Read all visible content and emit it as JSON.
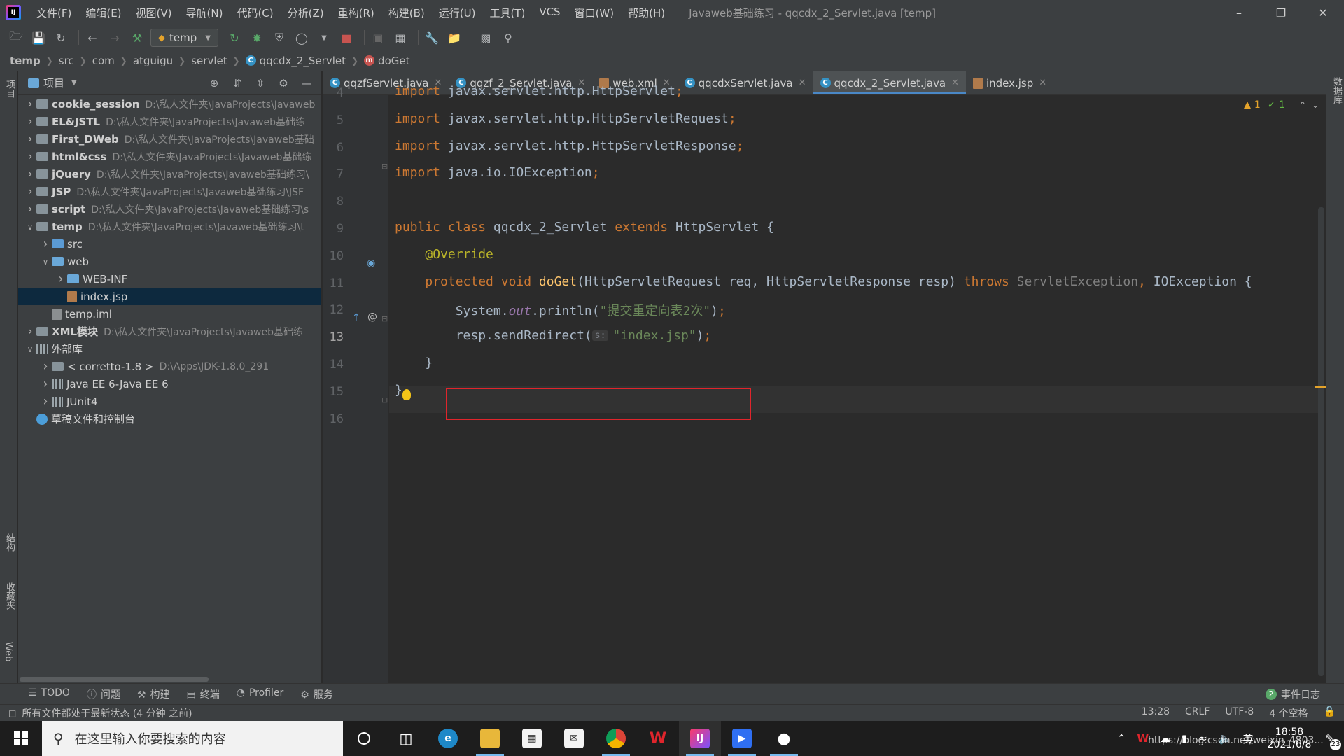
{
  "app": {
    "window_title": "Javaweb基础练习 - qqcdx_2_Servlet.java [temp]",
    "menu": [
      "文件(F)",
      "编辑(E)",
      "视图(V)",
      "导航(N)",
      "代码(C)",
      "分析(Z)",
      "重构(R)",
      "构建(B)",
      "运行(U)",
      "工具(T)",
      "VCS",
      "窗口(W)",
      "帮助(H)"
    ]
  },
  "toolbar": {
    "run_config": "temp"
  },
  "breadcrumb": [
    "temp",
    "src",
    "com",
    "atguigu",
    "servlet",
    "qqcdx_2_Servlet",
    "doGet"
  ],
  "project_panel": {
    "title": "项目",
    "tree": [
      {
        "name": "cookie_session",
        "path": "D:\\私人文件夹\\JavaProjects\\Javaweb",
        "level": 0,
        "expanded": false,
        "bold": true,
        "icon": "module-folder"
      },
      {
        "name": "EL&JSTL",
        "path": "D:\\私人文件夹\\JavaProjects\\Javaweb基础练",
        "level": 0,
        "expanded": false,
        "bold": true,
        "icon": "module-folder"
      },
      {
        "name": "First_DWeb",
        "path": "D:\\私人文件夹\\JavaProjects\\Javaweb基础",
        "level": 0,
        "expanded": false,
        "bold": true,
        "icon": "module-folder"
      },
      {
        "name": "html&css",
        "path": "D:\\私人文件夹\\JavaProjects\\Javaweb基础练",
        "level": 0,
        "expanded": false,
        "bold": true,
        "icon": "module-folder"
      },
      {
        "name": "jQuery",
        "path": "D:\\私人文件夹\\JavaProjects\\Javaweb基础练习\\",
        "level": 0,
        "expanded": false,
        "bold": true,
        "icon": "module-folder"
      },
      {
        "name": "JSP",
        "path": "D:\\私人文件夹\\JavaProjects\\Javaweb基础练习\\JSF",
        "level": 0,
        "expanded": false,
        "bold": true,
        "icon": "module-folder"
      },
      {
        "name": "script",
        "path": "D:\\私人文件夹\\JavaProjects\\Javaweb基础练习\\s",
        "level": 0,
        "expanded": false,
        "bold": true,
        "icon": "module-folder"
      },
      {
        "name": "temp",
        "path": "D:\\私人文件夹\\JavaProjects\\Javaweb基础练习\\t",
        "level": 0,
        "expanded": true,
        "bold": true,
        "icon": "module-folder"
      },
      {
        "name": "src",
        "path": "",
        "level": 1,
        "expanded": false,
        "bold": false,
        "icon": "source-folder"
      },
      {
        "name": "web",
        "path": "",
        "level": 1,
        "expanded": true,
        "bold": false,
        "icon": "web-folder"
      },
      {
        "name": "WEB-INF",
        "path": "",
        "level": 2,
        "expanded": false,
        "bold": false,
        "icon": "folder"
      },
      {
        "name": "index.jsp",
        "path": "",
        "level": 2,
        "expanded": null,
        "bold": false,
        "icon": "jsp-file",
        "selected": true
      },
      {
        "name": "temp.iml",
        "path": "",
        "level": 1,
        "expanded": null,
        "bold": false,
        "icon": "iml-file"
      },
      {
        "name": "XML模块",
        "path": "D:\\私人文件夹\\JavaProjects\\Javaweb基础练",
        "level": 0,
        "expanded": false,
        "bold": true,
        "icon": "module-folder"
      },
      {
        "name": "外部库",
        "path": "",
        "level": 0,
        "expanded": true,
        "bold": false,
        "icon": "library"
      },
      {
        "name": "< corretto-1.8 >",
        "path": "D:\\Apps\\JDK-1.8.0_291",
        "level": 1,
        "expanded": false,
        "bold": false,
        "icon": "jdk-folder"
      },
      {
        "name": "Java EE 6-Java EE 6",
        "path": "",
        "level": 1,
        "expanded": false,
        "bold": false,
        "icon": "library"
      },
      {
        "name": "JUnit4",
        "path": "",
        "level": 1,
        "expanded": false,
        "bold": false,
        "icon": "library"
      },
      {
        "name": "草稿文件和控制台",
        "path": "",
        "level": 0,
        "expanded": null,
        "bold": false,
        "icon": "scratch"
      }
    ]
  },
  "left_strip_labels": [
    "项目",
    "结构",
    "收藏夹",
    "Web"
  ],
  "right_strip_labels": [
    "数据库"
  ],
  "tabs": [
    {
      "label": "qqzfServlet.java",
      "icon": "class",
      "active": false
    },
    {
      "label": "qqzf_2_Servlet.java",
      "icon": "class",
      "active": false
    },
    {
      "label": "web.xml",
      "icon": "xml",
      "active": false
    },
    {
      "label": "qqcdxServlet.java",
      "icon": "class",
      "active": false
    },
    {
      "label": "qqcdx_2_Servlet.java",
      "icon": "class",
      "active": true
    },
    {
      "label": "index.jsp",
      "icon": "jsp",
      "active": false
    }
  ],
  "editor": {
    "inspections": {
      "warnings": "1",
      "ok": "1"
    },
    "current_line": "13",
    "lines": [
      {
        "num": "4",
        "tokens": [
          [
            "kw",
            "import "
          ],
          [
            "plain",
            "javax.servlet.http.HttpServlet"
          ],
          [
            "kw",
            ";"
          ]
        ]
      },
      {
        "num": "5",
        "tokens": [
          [
            "kw",
            "import "
          ],
          [
            "plain",
            "javax.servlet.http.HttpServletRequest"
          ],
          [
            "kw",
            ";"
          ]
        ]
      },
      {
        "num": "6",
        "tokens": [
          [
            "kw",
            "import "
          ],
          [
            "plain",
            "javax.servlet.http.HttpServletResponse"
          ],
          [
            "kw",
            ";"
          ]
        ]
      },
      {
        "num": "7",
        "tokens": [
          [
            "kw",
            "import "
          ],
          [
            "plain",
            "java.io.IOException"
          ],
          [
            "kw",
            ";"
          ]
        ]
      },
      {
        "num": "8",
        "tokens": []
      },
      {
        "num": "9",
        "tokens": [
          [
            "kw",
            "public class "
          ],
          [
            "plain",
            "qqcdx_2_Servlet "
          ],
          [
            "kw",
            "extends "
          ],
          [
            "plain",
            "HttpServlet {"
          ]
        ]
      },
      {
        "num": "10",
        "tokens": [
          [
            "plain",
            "    "
          ],
          [
            "ann",
            "@Override"
          ]
        ]
      },
      {
        "num": "11",
        "tokens": [
          [
            "plain",
            "    "
          ],
          [
            "kw",
            "protected void "
          ],
          [
            "fn",
            "doGet"
          ],
          [
            "plain",
            "(HttpServletRequest req, HttpServletResponse resp) "
          ],
          [
            "kw",
            "throws "
          ],
          [
            "grey",
            "ServletException"
          ],
          [
            "kw",
            ", "
          ],
          [
            "plain",
            "IOException {"
          ]
        ]
      },
      {
        "num": "12",
        "tokens": [
          [
            "plain",
            "        System."
          ],
          [
            "ital",
            "out"
          ],
          [
            "plain",
            ".println("
          ],
          [
            "str",
            "\"提交重定向表2次\""
          ],
          [
            "plain",
            ")"
          ],
          [
            "kw",
            ";"
          ]
        ]
      },
      {
        "num": "13",
        "tokens": [
          [
            "plain",
            "        resp.sendRedirect("
          ],
          [
            "hint",
            "s:"
          ],
          [
            "str",
            "\"index.jsp\""
          ],
          [
            "plain",
            ")"
          ],
          [
            "kw",
            ";"
          ]
        ]
      },
      {
        "num": "14",
        "tokens": [
          [
            "plain",
            "    }"
          ]
        ]
      },
      {
        "num": "15",
        "tokens": [
          [
            "plain",
            "}"
          ]
        ]
      },
      {
        "num": "16",
        "tokens": []
      }
    ]
  },
  "bottom_tools": [
    {
      "label": "TODO",
      "icon": "list-icon"
    },
    {
      "label": "问题",
      "icon": "problems-icon"
    },
    {
      "label": "构建",
      "icon": "hammer-icon"
    },
    {
      "label": "终端",
      "icon": "terminal-icon"
    },
    {
      "label": "Profiler",
      "icon": "profiler-icon"
    },
    {
      "label": "服务",
      "icon": "services-icon"
    }
  ],
  "event_log": {
    "count": "2",
    "label": "事件日志"
  },
  "status": {
    "message": "所有文件都处于最新状态 (4 分钟 之前)",
    "position": "13:28",
    "line_sep": "CRLF",
    "encoding": "UTF-8",
    "indent": "4 个空格"
  },
  "taskbar": {
    "search_placeholder": "在这里输入你要搜索的内容",
    "ime": "英",
    "time": "18:58",
    "date": "2021/6/8",
    "notification_count": "23",
    "watermark": "https://blog.csdn.net/weixin_4803..."
  },
  "colors": {
    "background": "#2b2b2b",
    "panel": "#3c3f41",
    "keyword": "#cc7832",
    "annotation": "#bbb529",
    "method": "#ffc66d",
    "string": "#6a8759",
    "highlight_box": "#e0252c",
    "tab_underline": "#4a88c7"
  }
}
